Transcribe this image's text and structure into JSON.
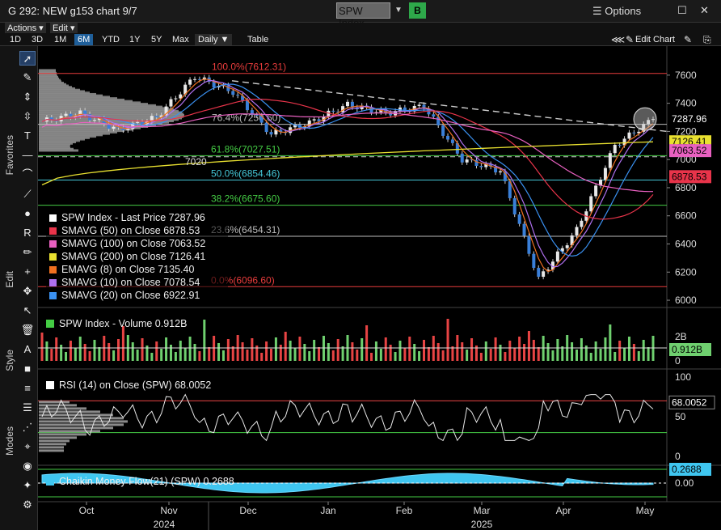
{
  "window": {
    "title": "G 292: NEW g153 chart 9/7",
    "ticker": "SPW Index",
    "b_button": "B",
    "options": "☰ Options",
    "restore": "☐",
    "close": "✕"
  },
  "menu": {
    "actions": "Actions ▾",
    "edit": "Edit ▾"
  },
  "toolbar": {
    "ranges": [
      "1D",
      "3D",
      "1M",
      "6M",
      "YTD",
      "1Y",
      "5Y",
      "Max"
    ],
    "selected_range": "6M",
    "frequency": "Daily ▼",
    "table": "Table",
    "edit_chart": "Edit Chart"
  },
  "sidebar": {
    "favorites": "Favorites",
    "edit": "Edit",
    "style": "Style",
    "modes": "Modes"
  },
  "fib_levels": [
    {
      "label": "100.0%(7612.31)",
      "value": 7612.31,
      "color": "#e83c3c"
    },
    {
      "label": "76.4%(7250.60)",
      "value": 7250.6,
      "color": "#bbbbbb"
    },
    {
      "label": "61.8%(7027.51)",
      "value": 7027.51,
      "color": "#44cc44"
    },
    {
      "label": "50.0%(6854.46)",
      "value": 6854.46,
      "color": "#45c8d8"
    },
    {
      "label": "38.2%(6675.60)",
      "value": 6675.6,
      "color": "#44cc44"
    },
    {
      "label": "23.6%(6454.31)",
      "value": 6454.31,
      "color": "#bbbbbb"
    },
    {
      "label": "0.0%(6096.60)",
      "value": 6096.6,
      "color": "#e83c3c"
    }
  ],
  "price_legend": [
    {
      "label": "SPW Index - Last Price 7287.96",
      "color": "#ffffff"
    },
    {
      "label": "SMAVG (50)  on Close    6878.53",
      "color": "#e8344a"
    },
    {
      "label": "SMAVG (100)  on Close  7063.52",
      "color": "#e860c0"
    },
    {
      "label": "SMAVG (200)  on Close  7126.41",
      "color": "#e8e030"
    },
    {
      "label": "EMAVG (8)  on Close    7135.40",
      "color": "#f07020"
    },
    {
      "label": "SMAVG (10)  on Close   7078.54",
      "color": "#b070f0"
    },
    {
      "label": "SMAVG (20)  on Close   6922.91",
      "color": "#3a90f0"
    }
  ],
  "volume_title": "SPW Index - Volume 0.912B",
  "rsi_title": "RSI (14)  on Close (SPW) 68.0052",
  "cmf_title": "Chaikin Money Flow(21) (SPW) 0.2688",
  "support_label": "7020",
  "price_badges": [
    {
      "value": "7287.96",
      "bg": "#000000",
      "fg": "#ffffff"
    },
    {
      "value": "7126.41",
      "bg": "#e8e030",
      "fg": "#000000"
    },
    {
      "value": "7063.52",
      "bg": "#e860c0",
      "fg": "#000000"
    },
    {
      "value": "6878.53",
      "bg": "#e8344a",
      "fg": "#000000"
    }
  ],
  "volume_badge": "0.912B",
  "rsi_badge": "68.0052",
  "cmf_badge": "0.2688",
  "x_months": [
    "Oct",
    "Nov",
    "Dec",
    "Jan",
    "Feb",
    "Mar",
    "Apr",
    "May"
  ],
  "x_years": [
    "2024",
    "2025"
  ],
  "chart_data": [
    {
      "type": "line",
      "title": "SPW Index - Last Price",
      "y_ticks": [
        6000,
        6200,
        6400,
        6600,
        6800,
        7000,
        7200,
        7400,
        7600
      ],
      "ylim": [
        5960,
        7720
      ],
      "x_months": [
        "Oct",
        "Nov",
        "Dec",
        "Jan",
        "Feb",
        "Mar",
        "Apr",
        "May"
      ],
      "series": [
        {
          "name": "SPW Index - Last Price",
          "last": 7287.96
        },
        {
          "name": "SMAVG (50)",
          "last": 6878.53
        },
        {
          "name": "SMAVG (100)",
          "last": 7063.52
        },
        {
          "name": "SMAVG (200)",
          "last": 7126.41
        },
        {
          "name": "EMAVG (8)",
          "last": 7135.4
        },
        {
          "name": "SMAVG (10)",
          "last": 7078.54
        },
        {
          "name": "SMAVG (20)",
          "last": 6922.91
        }
      ],
      "close_approx": [
        {
          "x": "Sep",
          "y": 7270
        },
        {
          "x": "Oct",
          "y": 7330
        },
        {
          "x": "Oct-mid",
          "y": 7210
        },
        {
          "x": "Nov",
          "y": 7300
        },
        {
          "x": "Nov-mid",
          "y": 7590
        },
        {
          "x": "Dec",
          "y": 7480
        },
        {
          "x": "Dec-mid",
          "y": 7180
        },
        {
          "x": "Jan",
          "y": 7260
        },
        {
          "x": "Jan-mid",
          "y": 7390
        },
        {
          "x": "Feb",
          "y": 7330
        },
        {
          "x": "Feb-mid",
          "y": 7380
        },
        {
          "x": "Mar",
          "y": 7000
        },
        {
          "x": "Mar-mid",
          "y": 6920
        },
        {
          "x": "Apr",
          "y": 6150
        },
        {
          "x": "Apr-mid",
          "y": 6500
        },
        {
          "x": "May",
          "y": 7100
        },
        {
          "x": "May-end",
          "y": 7287.96
        }
      ]
    },
    {
      "type": "bar",
      "title": "SPW Index - Volume",
      "y_ticks": [
        "0",
        "2B"
      ],
      "last": "0.912B"
    },
    {
      "type": "line",
      "title": "RSI (14) on Close (SPW)",
      "y_ticks": [
        0,
        50,
        100
      ],
      "levels": [
        30,
        70
      ],
      "last": 68.0052
    },
    {
      "type": "area",
      "title": "Chaikin Money Flow(21) (SPW)",
      "y_ticks": [
        "0.00"
      ],
      "last": 0.2688
    }
  ]
}
